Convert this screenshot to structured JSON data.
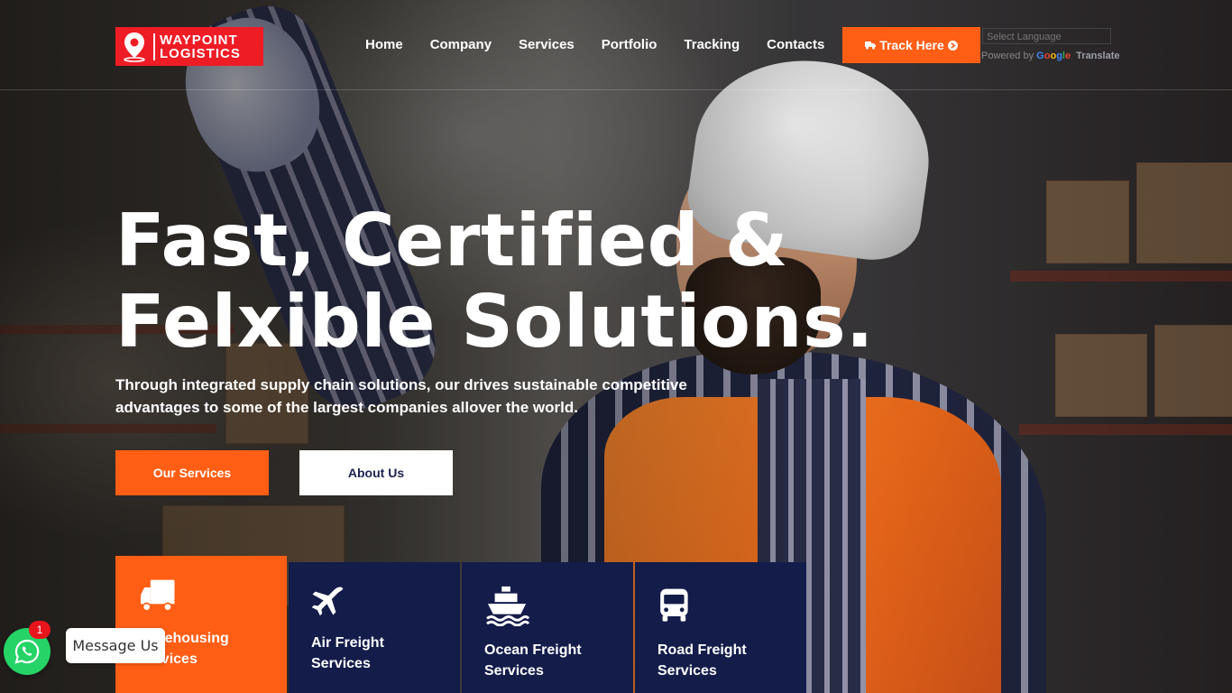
{
  "brand": {
    "line1": "WAYPOINT",
    "line2": "LOGISTICS",
    "color": "#ee1c25"
  },
  "nav": {
    "items": [
      {
        "label": "Home"
      },
      {
        "label": "Company"
      },
      {
        "label": "Services"
      },
      {
        "label": "Portfolio"
      },
      {
        "label": "Tracking"
      },
      {
        "label": "Contacts"
      }
    ]
  },
  "header": {
    "track_button": "Track Here",
    "language_select": "Select Language",
    "powered_by": "Powered by",
    "google": "Google",
    "translate": "Translate"
  },
  "hero": {
    "title_line1": "Fast, Certified &",
    "title_line2": "Felxible Solutions.",
    "description": "Through integrated supply chain solutions, our drives sustainable competitive advantages to some of the largest companies allover the world.",
    "primary_button": "Our Services",
    "secondary_button": "About Us"
  },
  "services": [
    {
      "label": "Warehousing Services",
      "icon": "truck-icon"
    },
    {
      "label": "Air Freight Services",
      "icon": "airplane-icon"
    },
    {
      "label": "Ocean Freight Services",
      "icon": "ship-icon"
    },
    {
      "label": "Road Freight Services",
      "icon": "bus-icon"
    }
  ],
  "whatsapp": {
    "badge": "1",
    "label": "Message Us"
  },
  "colors": {
    "accent": "#ff5e14",
    "navy": "#141c4a",
    "whatsapp": "#25d366"
  }
}
